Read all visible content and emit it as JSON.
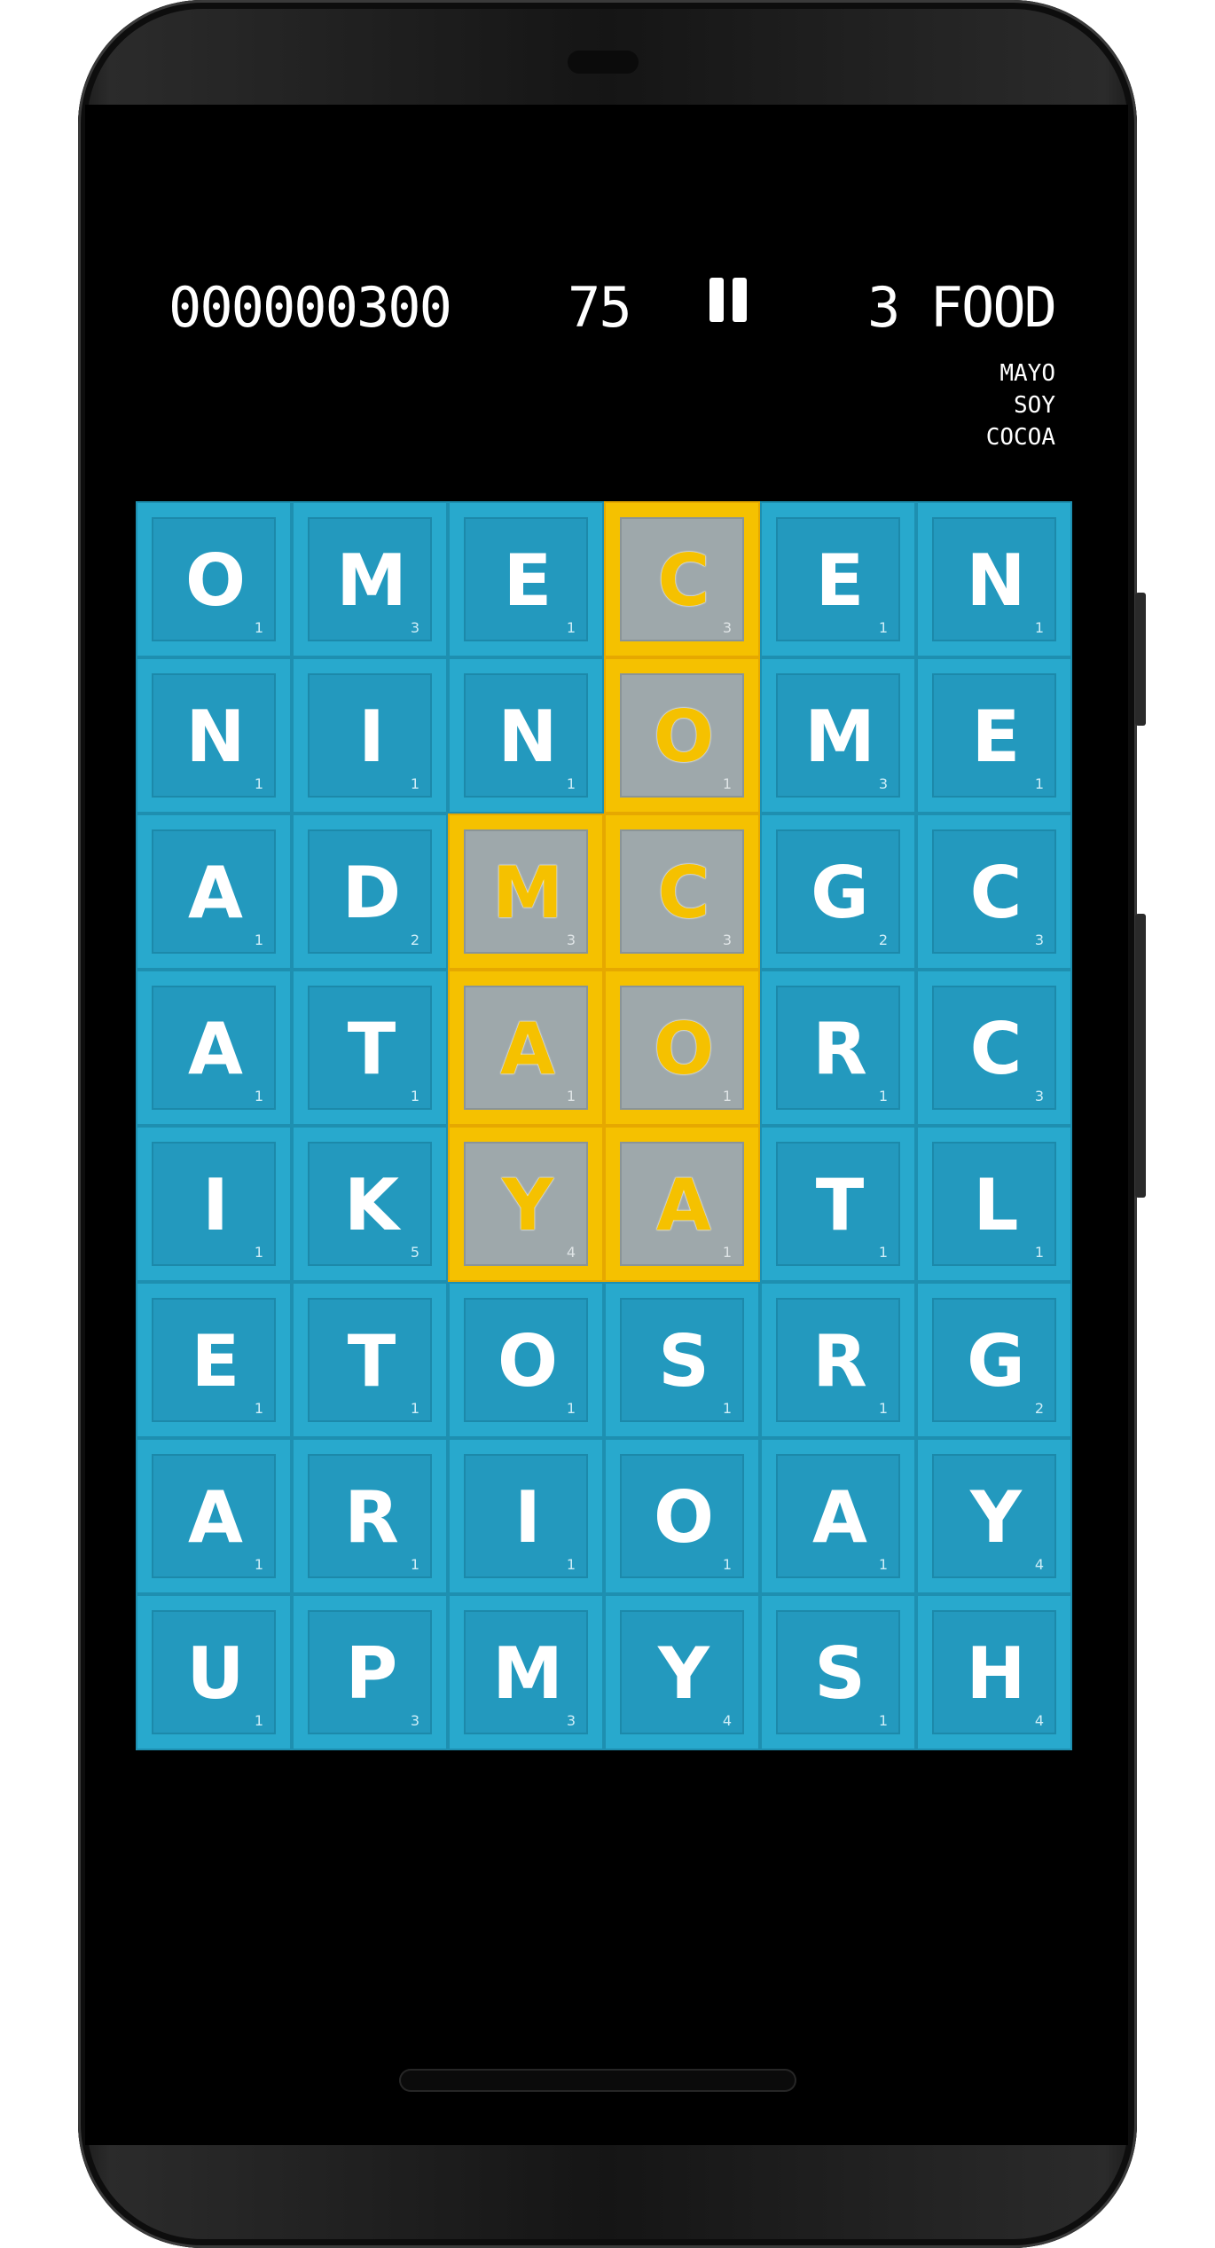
{
  "hud": {
    "score": "000000300",
    "timer": "75",
    "category": "3 FOOD",
    "found_words": [
      "MAYO",
      "SOY",
      "COCOA"
    ]
  },
  "colors": {
    "tile": "#28a9cd",
    "tile_selected": "#f5c100",
    "tile_selected_inner": "#9ea8ab",
    "screen": "#000000"
  },
  "icons": {
    "pause": "pause-icon"
  },
  "board": {
    "rows": [
      [
        {
          "l": "O",
          "p": "1"
        },
        {
          "l": "M",
          "p": "3"
        },
        {
          "l": "E",
          "p": "1"
        },
        {
          "l": "C",
          "p": "3",
          "s": true
        },
        {
          "l": "E",
          "p": "1"
        },
        {
          "l": "N",
          "p": "1"
        }
      ],
      [
        {
          "l": "N",
          "p": "1"
        },
        {
          "l": "I",
          "p": "1"
        },
        {
          "l": "N",
          "p": "1"
        },
        {
          "l": "O",
          "p": "1",
          "s": true
        },
        {
          "l": "M",
          "p": "3"
        },
        {
          "l": "E",
          "p": "1"
        }
      ],
      [
        {
          "l": "A",
          "p": "1"
        },
        {
          "l": "D",
          "p": "2"
        },
        {
          "l": "M",
          "p": "3",
          "s": true
        },
        {
          "l": "C",
          "p": "3",
          "s": true
        },
        {
          "l": "G",
          "p": "2"
        },
        {
          "l": "C",
          "p": "3"
        }
      ],
      [
        {
          "l": "A",
          "p": "1"
        },
        {
          "l": "T",
          "p": "1"
        },
        {
          "l": "A",
          "p": "1",
          "s": true
        },
        {
          "l": "O",
          "p": "1",
          "s": true
        },
        {
          "l": "R",
          "p": "1"
        },
        {
          "l": "C",
          "p": "3"
        }
      ],
      [
        {
          "l": "I",
          "p": "1"
        },
        {
          "l": "K",
          "p": "5"
        },
        {
          "l": "Y",
          "p": "4",
          "s": true
        },
        {
          "l": "A",
          "p": "1",
          "s": true
        },
        {
          "l": "T",
          "p": "1"
        },
        {
          "l": "L",
          "p": "1"
        }
      ],
      [
        {
          "l": "E",
          "p": "1"
        },
        {
          "l": "T",
          "p": "1"
        },
        {
          "l": "O",
          "p": "1"
        },
        {
          "l": "S",
          "p": "1"
        },
        {
          "l": "R",
          "p": "1"
        },
        {
          "l": "G",
          "p": "2"
        }
      ],
      [
        {
          "l": "A",
          "p": "1"
        },
        {
          "l": "R",
          "p": "1"
        },
        {
          "l": "I",
          "p": "1"
        },
        {
          "l": "O",
          "p": "1"
        },
        {
          "l": "A",
          "p": "1"
        },
        {
          "l": "Y",
          "p": "4"
        }
      ],
      [
        {
          "l": "U",
          "p": "1"
        },
        {
          "l": "P",
          "p": "3"
        },
        {
          "l": "M",
          "p": "3"
        },
        {
          "l": "Y",
          "p": "4"
        },
        {
          "l": "S",
          "p": "1"
        },
        {
          "l": "H",
          "p": "4"
        }
      ]
    ]
  }
}
